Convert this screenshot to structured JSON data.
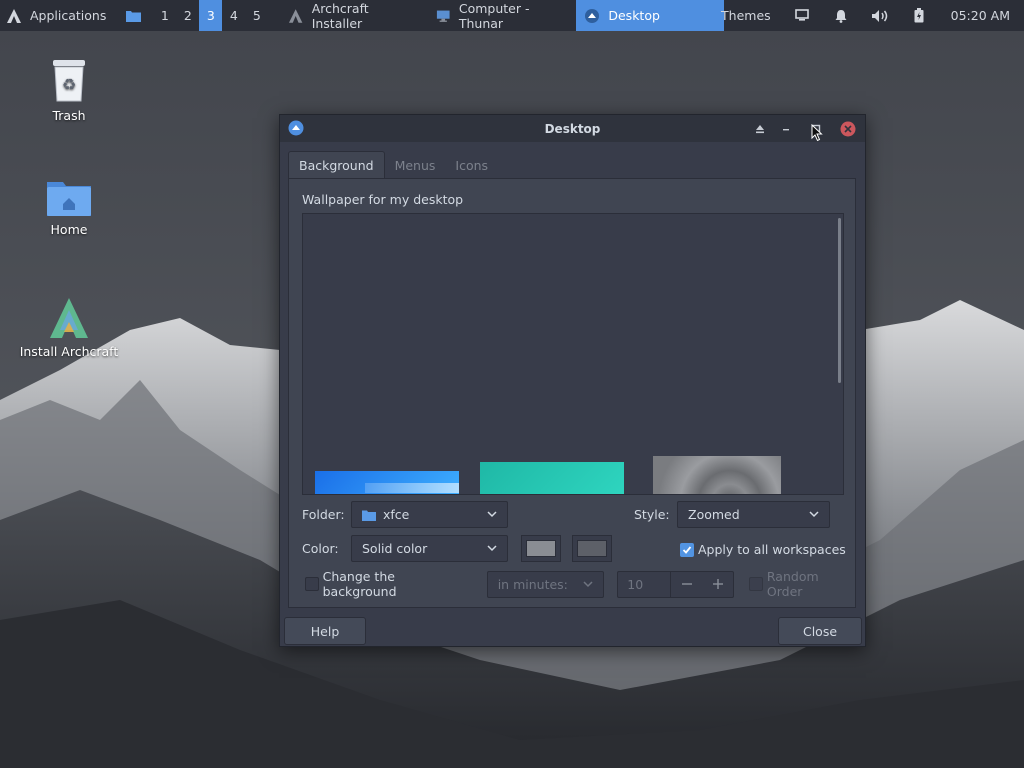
{
  "panel": {
    "apps_label": "Applications",
    "workspaces": [
      "1",
      "2",
      "3",
      "4",
      "5"
    ],
    "active_workspace": "3",
    "tasks": [
      {
        "label": "Archcraft Installer",
        "icon": "archcraft-icon"
      },
      {
        "label": "Computer - Thunar",
        "icon": "monitor-icon"
      },
      {
        "label": "Desktop",
        "icon": "desktop-settings-icon",
        "active": true
      }
    ],
    "themes_label": "Themes",
    "clock": "05:20 AM"
  },
  "desktop_icons": [
    {
      "label": "Trash",
      "icon": "trash-icon"
    },
    {
      "label": "Home",
      "icon": "home-folder-icon"
    },
    {
      "label": "Install Archcraft",
      "icon": "archcraft-logo-icon"
    }
  ],
  "window": {
    "title": "Desktop",
    "tabs": [
      "Background",
      "Menus",
      "Icons"
    ],
    "active_tab": "Background",
    "section_label": "Wallpaper for my desktop",
    "folder_label": "Folder:",
    "folder_value": "xfce",
    "style_label": "Style:",
    "style_value": "Zoomed",
    "color_label": "Color:",
    "color_value": "Solid color",
    "apply_all_label": "Apply to all workspaces",
    "apply_all_checked": true,
    "change_bg_label": "Change the background",
    "change_bg_checked": false,
    "interval_unit": "in minutes:",
    "interval_value": "10",
    "random_order_label": "Random Order",
    "help_button": "Help",
    "close_button": "Close",
    "colors": {
      "accent": "#5294e2",
      "swatch1": "#8a8d93",
      "swatch2": "#5d6068"
    }
  }
}
